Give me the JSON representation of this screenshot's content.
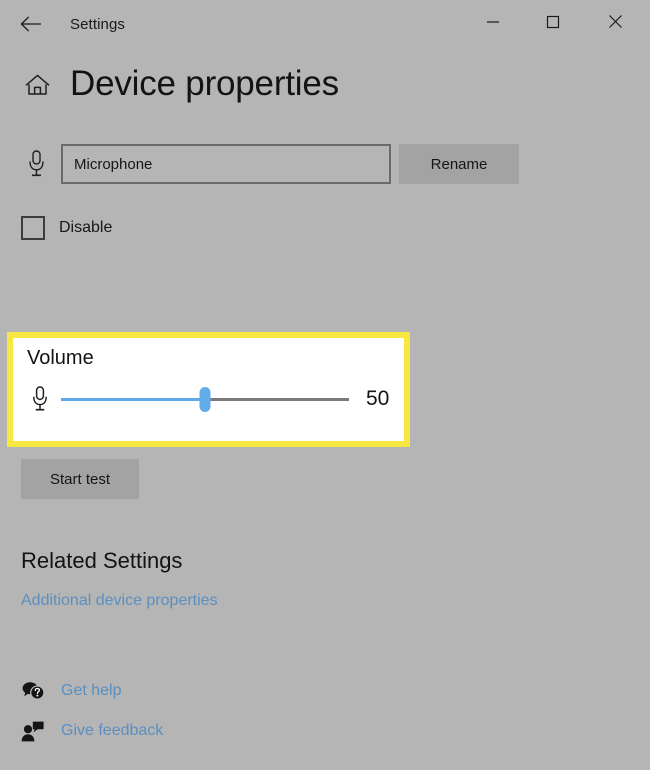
{
  "window": {
    "app_title": "Settings",
    "back_icon": "back-arrow-icon",
    "minimize_label": "—",
    "maximize_label": "□",
    "close_label": "✕"
  },
  "page": {
    "home_icon": "home-icon",
    "title": "Device properties"
  },
  "device": {
    "icon": "microphone-icon",
    "name_value": "Microphone",
    "name_placeholder": "Microphone",
    "rename_label": "Rename",
    "disable_label": "Disable",
    "disable_checked": false
  },
  "volume": {
    "label": "Volume",
    "icon": "microphone-icon",
    "value": 50,
    "value_text": "50",
    "min": 0,
    "max": 100,
    "fill_color": "#5fa9e8",
    "track_color": "#7b7b7b",
    "thumb_color": "#62acea",
    "highlight_color": "#f7e740",
    "card_background": "#ffffff"
  },
  "test": {
    "start_test_label": "Start test"
  },
  "related": {
    "heading": "Related Settings",
    "link_label": "Additional device properties",
    "link_color": "#5a8fc0"
  },
  "footer": {
    "help_icon": "question-bubble-icon",
    "help_label": "Get help",
    "feedback_icon": "feedback-person-icon",
    "feedback_label": "Give feedback"
  }
}
